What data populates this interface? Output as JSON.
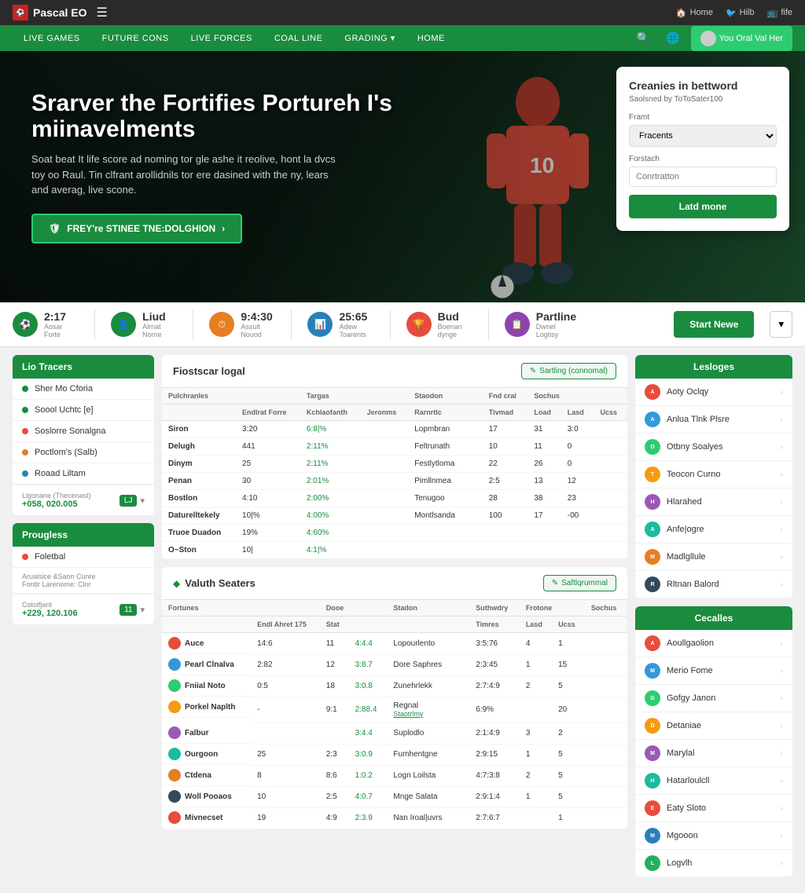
{
  "topbar": {
    "logo": "Pascal EO",
    "nav_right": [
      "Home",
      "Hilb",
      "fife"
    ]
  },
  "nav": {
    "links": [
      "LIVE GAMES",
      "FUTURE CONS",
      "LIVE FORCES",
      "COAL LINE",
      "GRADING",
      "HOME"
    ],
    "grading_has_arrow": true,
    "user_btn": "You Oral Val Her"
  },
  "hero": {
    "title": "Srarver the Fortifies Portureh I's miinavelments",
    "subtitle": "Soat beat It life score ad noming tor gle ashe it reolive, hont la dvcs toy oo Raul. Tin clfrant arollidnils tor ere dasined with the ny, lears and averag, live scone.",
    "cta": "FREY're STINEE TNE:DOLGHION"
  },
  "hero_card": {
    "title": "Creanies in bettword",
    "subtitle": "Saolsned by ToToSater100",
    "field1_label": "Framt",
    "field1_placeholder": "Fracents",
    "field2_label": "Forstach",
    "field2_placeholder": "Conrtratton",
    "button": "Latd mone"
  },
  "stats": [
    {
      "value": "2:17",
      "label": "Aosar Forte",
      "icon": "⚽"
    },
    {
      "value": "Liud",
      "label": "Alrnat Norne",
      "icon": "👤"
    },
    {
      "value": "9:4:30",
      "label": "Assult Nouod",
      "icon": "⏱",
      "color": "orange"
    },
    {
      "value": "25:65",
      "label": "Adew Toarents",
      "icon": "📊",
      "color": "blue"
    },
    {
      "value": "Bud",
      "label": "Boenan dynge",
      "icon": "🏆",
      "color": "red"
    },
    {
      "value": "Partline",
      "label": "Dwnel Logtisy",
      "icon": "📋",
      "color": "purple"
    }
  ],
  "start_now": "Start Newe",
  "sidebar": {
    "section1_title": "Lio Tracers",
    "items1": [
      {
        "label": "Sher Mo Cforia",
        "dot": "green"
      },
      {
        "label": "Soool Uchtc [e]",
        "dot": "green"
      },
      {
        "label": "Soslorre Sonalgna",
        "dot": "red"
      },
      {
        "label": "Poctlom's (Salb)",
        "dot": "orange"
      },
      {
        "label": "Roaad Liltam",
        "dot": "blue"
      }
    ],
    "counter1_label": "Llgonane (Thecenast)",
    "counter1_value": "+058, 020.005",
    "counter1_badge": "LJ",
    "section2_title": "Prougless",
    "items2": [
      {
        "label": "Foletbal"
      }
    ],
    "items2_sub": "Arualsice &Saon Cunre\nFontlr Larenome: Clnr",
    "counter2_label": "Cotolfjant",
    "counter2_value": "+229, 120.106",
    "counter2_badge": "11"
  },
  "table1": {
    "title": "Fiostscar logal",
    "action": "Sartling (connomal)",
    "cols": [
      "Pulchranles",
      "",
      "Targas",
      "",
      "Staodon",
      "",
      "Fnd cral",
      "Sochus"
    ],
    "subcols": [
      "",
      "Endlrat Forre",
      "Kchlaofanth Jeronms",
      "Rarnrtlc",
      "Tivmad Load",
      "Lasd Ucss"
    ],
    "rows": [
      {
        "name": "Siron",
        "v1": "3:20",
        "v2": "6:8|%",
        "loc": "Lopmbran",
        "v3": "17",
        "v4": "31",
        "v5": "3:0"
      },
      {
        "name": "Delugh",
        "v1": "441",
        "v2": "2:11%",
        "loc": "Feltrunath",
        "v3": "10",
        "v4": "11",
        "v5": "0"
      },
      {
        "name": "Dinym",
        "v1": "25",
        "v2": "2:11%",
        "loc": "Festlytloma",
        "v3": "22",
        "v4": "26",
        "v5": "0"
      },
      {
        "name": "Penan",
        "v1": "30",
        "v2": "2:01%",
        "loc": "Pimllnmea",
        "v3": "2:5",
        "v4": "13",
        "v5": "12"
      },
      {
        "name": "Bostlon",
        "v1": "4:10",
        "v2": "2:00%",
        "loc": "Tenugoo",
        "v3": "28",
        "v4": "38",
        "v5": "23"
      },
      {
        "name": "Daturelltekely",
        "v1": "10|%",
        "v2": "4:00%",
        "loc": "Montlsanda",
        "v3": "100",
        "v4": "17",
        "v5": "-00"
      },
      {
        "name": "Truoe Duadon",
        "v1": "19%",
        "v2": "4:60%",
        "loc": "",
        "v3": "",
        "v4": "",
        "v5": ""
      },
      {
        "name": "O~Ston",
        "v1": "10|",
        "v2": "4:1|%",
        "loc": "",
        "v3": "",
        "v4": "",
        "v5": ""
      }
    ]
  },
  "table2": {
    "title": "Valuth Seaters",
    "action": "Saftlqrummal",
    "cols": [
      "Fortunes",
      "Dooe",
      "Stadon",
      "Suthwdry",
      "Frotone",
      "Sochus"
    ],
    "subcols": [
      "",
      "Endl Ahret 175",
      "Stat",
      "",
      "Timres",
      "Lasd Ucss"
    ],
    "rows": [
      {
        "name": "Auce",
        "color": "c1",
        "v1": "14:6",
        "v2": "11",
        "v3": "4:4.4",
        "loc": "Lopourlento",
        "v4": "3:5:76",
        "v5": "4",
        "v6": "1"
      },
      {
        "name": "Pearl Clnalva",
        "color": "c2",
        "v1": "2:82",
        "v2": "12",
        "v3": "3:8.7",
        "loc": "Dore Saphres",
        "v4": "2:3:45",
        "v5": "1",
        "v6": "15"
      },
      {
        "name": "Fniial Noto",
        "color": "c3",
        "v1": "0:5",
        "v2": "18",
        "v3": "3:0.8",
        "loc": "Zunehrlekk",
        "v4": "2:7:4:9",
        "v5": "2",
        "v6": "5"
      },
      {
        "name": "Porkel Naplth",
        "color": "c4",
        "v1": "-",
        "v2": "9:1",
        "v3": "2:88.4",
        "loc": "Regnal",
        "v4": "6:9%",
        "v5": "",
        "v6": "20",
        "link": "Staotrlmy"
      },
      {
        "name": "Falbur",
        "color": "c5",
        "v1": "",
        "v2": "",
        "v3": "3:4.4",
        "loc": "Suplodlo",
        "v4": "2:1:4:9",
        "v5": "3",
        "v6": "2"
      },
      {
        "name": "Ourgoon",
        "color": "c6",
        "v1": "25",
        "v2": "2:3",
        "v3": "3:0.9",
        "loc": "Fumhentgne",
        "v4": "2:9:15",
        "v5": "1",
        "v6": "5"
      },
      {
        "name": "Ctdena",
        "color": "c7",
        "v1": "8",
        "v2": "8:6",
        "v3": "1:0.2",
        "loc": "Logn Loilsta",
        "v4": "4:7:3:8",
        "v5": "2",
        "v6": "5"
      },
      {
        "name": "Woll Pooaos",
        "color": "c8",
        "v1": "10",
        "v2": "2:5",
        "v3": "4:0.7",
        "loc": "Mnge Salata",
        "v4": "2:9:1:4",
        "v5": "1",
        "v6": "5"
      },
      {
        "name": "Mivnecset",
        "color": "c9",
        "v1": "19",
        "v2": "4:9",
        "v3": "2:3.9",
        "loc": "Nan Iroal|uvrs",
        "v4": "2:7:6:7",
        "v5": "",
        "v6": "1"
      }
    ]
  },
  "right": {
    "section1_title": "Lesloges",
    "leagues": [
      {
        "name": "Aoty Oclqy",
        "color": "c1"
      },
      {
        "name": "Anlua Tlnk Plsre",
        "color": "c2"
      },
      {
        "name": "Otbny Soalyes",
        "color": "c3"
      },
      {
        "name": "Teocon Curno",
        "color": "c4"
      },
      {
        "name": "Hlarahed",
        "color": "c5"
      },
      {
        "name": "Anfe|ogre",
        "color": "c6"
      },
      {
        "name": "Madlgllule",
        "color": "c7"
      },
      {
        "name": "Rltnan Balord",
        "color": "c8"
      }
    ],
    "section2_title": "Cecalles",
    "countries": [
      {
        "name": "Aoullgaolion",
        "color": "c1"
      },
      {
        "name": "Merio Fome",
        "color": "c2"
      },
      {
        "name": "Gofgy Janon",
        "color": "c3"
      },
      {
        "name": "Detaniae",
        "color": "c4"
      },
      {
        "name": "Marylal",
        "color": "c5"
      },
      {
        "name": "Hatarloulcll",
        "color": "c6"
      },
      {
        "name": "Eaty Sloto",
        "color": "c9"
      },
      {
        "name": "Mgooon",
        "color": "c10"
      },
      {
        "name": "Logvlh",
        "color": "c11"
      }
    ]
  }
}
